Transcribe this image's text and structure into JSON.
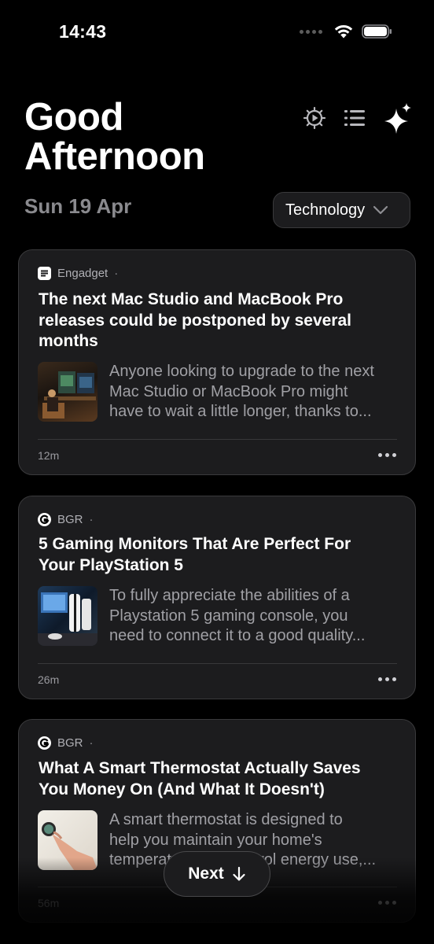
{
  "status": {
    "time": "14:43"
  },
  "header": {
    "greeting_line1": "Good",
    "greeting_line2": "Afternoon",
    "date": "Sun 19 Apr",
    "category": "Technology"
  },
  "icons": {
    "settings": "gear-play-icon",
    "list": "list-icon",
    "sparkle": "sparkles-icon"
  },
  "articles": [
    {
      "source": "Engadget",
      "dot": "·",
      "title_lines": [
        "The next Mac Studio and MacBook Pro",
        "releases could be postponed by several",
        "months"
      ],
      "summary_lines": [
        "Anyone looking to upgrade to the next",
        "Mac Studio or MacBook Pro might",
        "have to wait a little longer, thanks to..."
      ],
      "time": "12m"
    },
    {
      "source": "BGR",
      "dot": "·",
      "title_lines": [
        "5 Gaming Monitors That Are Perfect For",
        "Your PlayStation 5"
      ],
      "summary_lines": [
        "To fully appreciate the abilities of a",
        "Playstation 5 gaming console, you",
        "need to connect it to a good quality..."
      ],
      "time": "26m"
    },
    {
      "source": "BGR",
      "dot": "·",
      "title_lines": [
        "What A Smart Thermostat Actually Saves",
        "You Money On (And What It Doesn't)"
      ],
      "summary_lines": [
        "A smart thermostat is designed to",
        "help you maintain your home's",
        "temperature and control energy use,..."
      ],
      "time": "56m"
    }
  ],
  "next_button": {
    "label": "Next"
  },
  "colors": {
    "background": "#000000",
    "card": "#1c1c1e",
    "border": "#3a3a3c",
    "muted_text": "#a0a0a5"
  }
}
